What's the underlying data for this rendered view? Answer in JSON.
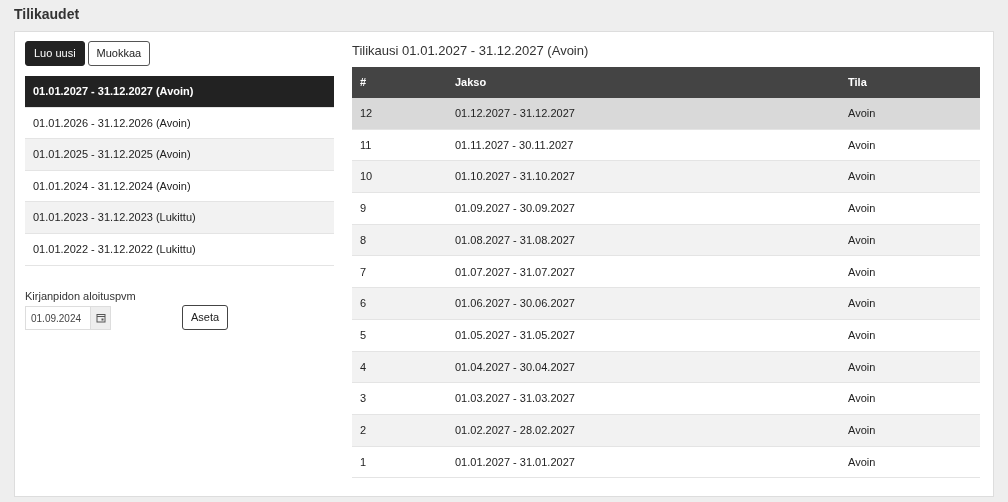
{
  "page_title": "Tilikaudet",
  "buttons": [
    {
      "label": "Luo uusi",
      "kind": "primary"
    },
    {
      "label": "Muokkaa",
      "kind": "secondary"
    }
  ],
  "periods": [
    {
      "label": "01.01.2027 - 31.12.2027 (Avoin)",
      "selected": true
    },
    {
      "label": "01.01.2026 - 31.12.2026 (Avoin)",
      "selected": false
    },
    {
      "label": "01.01.2025 - 31.12.2025 (Avoin)",
      "selected": false
    },
    {
      "label": "01.01.2024 - 31.12.2024 (Avoin)",
      "selected": false
    },
    {
      "label": "01.01.2023 - 31.12.2023 (Lukittu)",
      "selected": false
    },
    {
      "label": "01.01.2022 - 31.12.2022 (Lukittu)",
      "selected": false
    }
  ],
  "start_date": {
    "label": "Kirjanpidon aloituspvm",
    "value": "01.09.2024",
    "button": "Aseta"
  },
  "detail": {
    "title": "Tilikausi 01.01.2027 - 31.12.2027 (Avoin)",
    "columns": [
      "#",
      "Jakso",
      "Tila"
    ],
    "rows": [
      {
        "cells": [
          "12",
          "01.12.2027 - 31.12.2027",
          "Avoin"
        ],
        "selected": true
      },
      {
        "cells": [
          "11",
          "01.11.2027 - 30.11.2027",
          "Avoin"
        ],
        "selected": false
      },
      {
        "cells": [
          "10",
          "01.10.2027 - 31.10.2027",
          "Avoin"
        ],
        "selected": false
      },
      {
        "cells": [
          "9",
          "01.09.2027 - 30.09.2027",
          "Avoin"
        ],
        "selected": false
      },
      {
        "cells": [
          "8",
          "01.08.2027 - 31.08.2027",
          "Avoin"
        ],
        "selected": false
      },
      {
        "cells": [
          "7",
          "01.07.2027 - 31.07.2027",
          "Avoin"
        ],
        "selected": false
      },
      {
        "cells": [
          "6",
          "01.06.2027 - 30.06.2027",
          "Avoin"
        ],
        "selected": false
      },
      {
        "cells": [
          "5",
          "01.05.2027 - 31.05.2027",
          "Avoin"
        ],
        "selected": false
      },
      {
        "cells": [
          "4",
          "01.04.2027 - 30.04.2027",
          "Avoin"
        ],
        "selected": false
      },
      {
        "cells": [
          "3",
          "01.03.2027 - 31.03.2027",
          "Avoin"
        ],
        "selected": false
      },
      {
        "cells": [
          "2",
          "01.02.2027 - 28.02.2027",
          "Avoin"
        ],
        "selected": false
      },
      {
        "cells": [
          "1",
          "01.01.2027 - 31.01.2027",
          "Avoin"
        ],
        "selected": false
      }
    ]
  }
}
